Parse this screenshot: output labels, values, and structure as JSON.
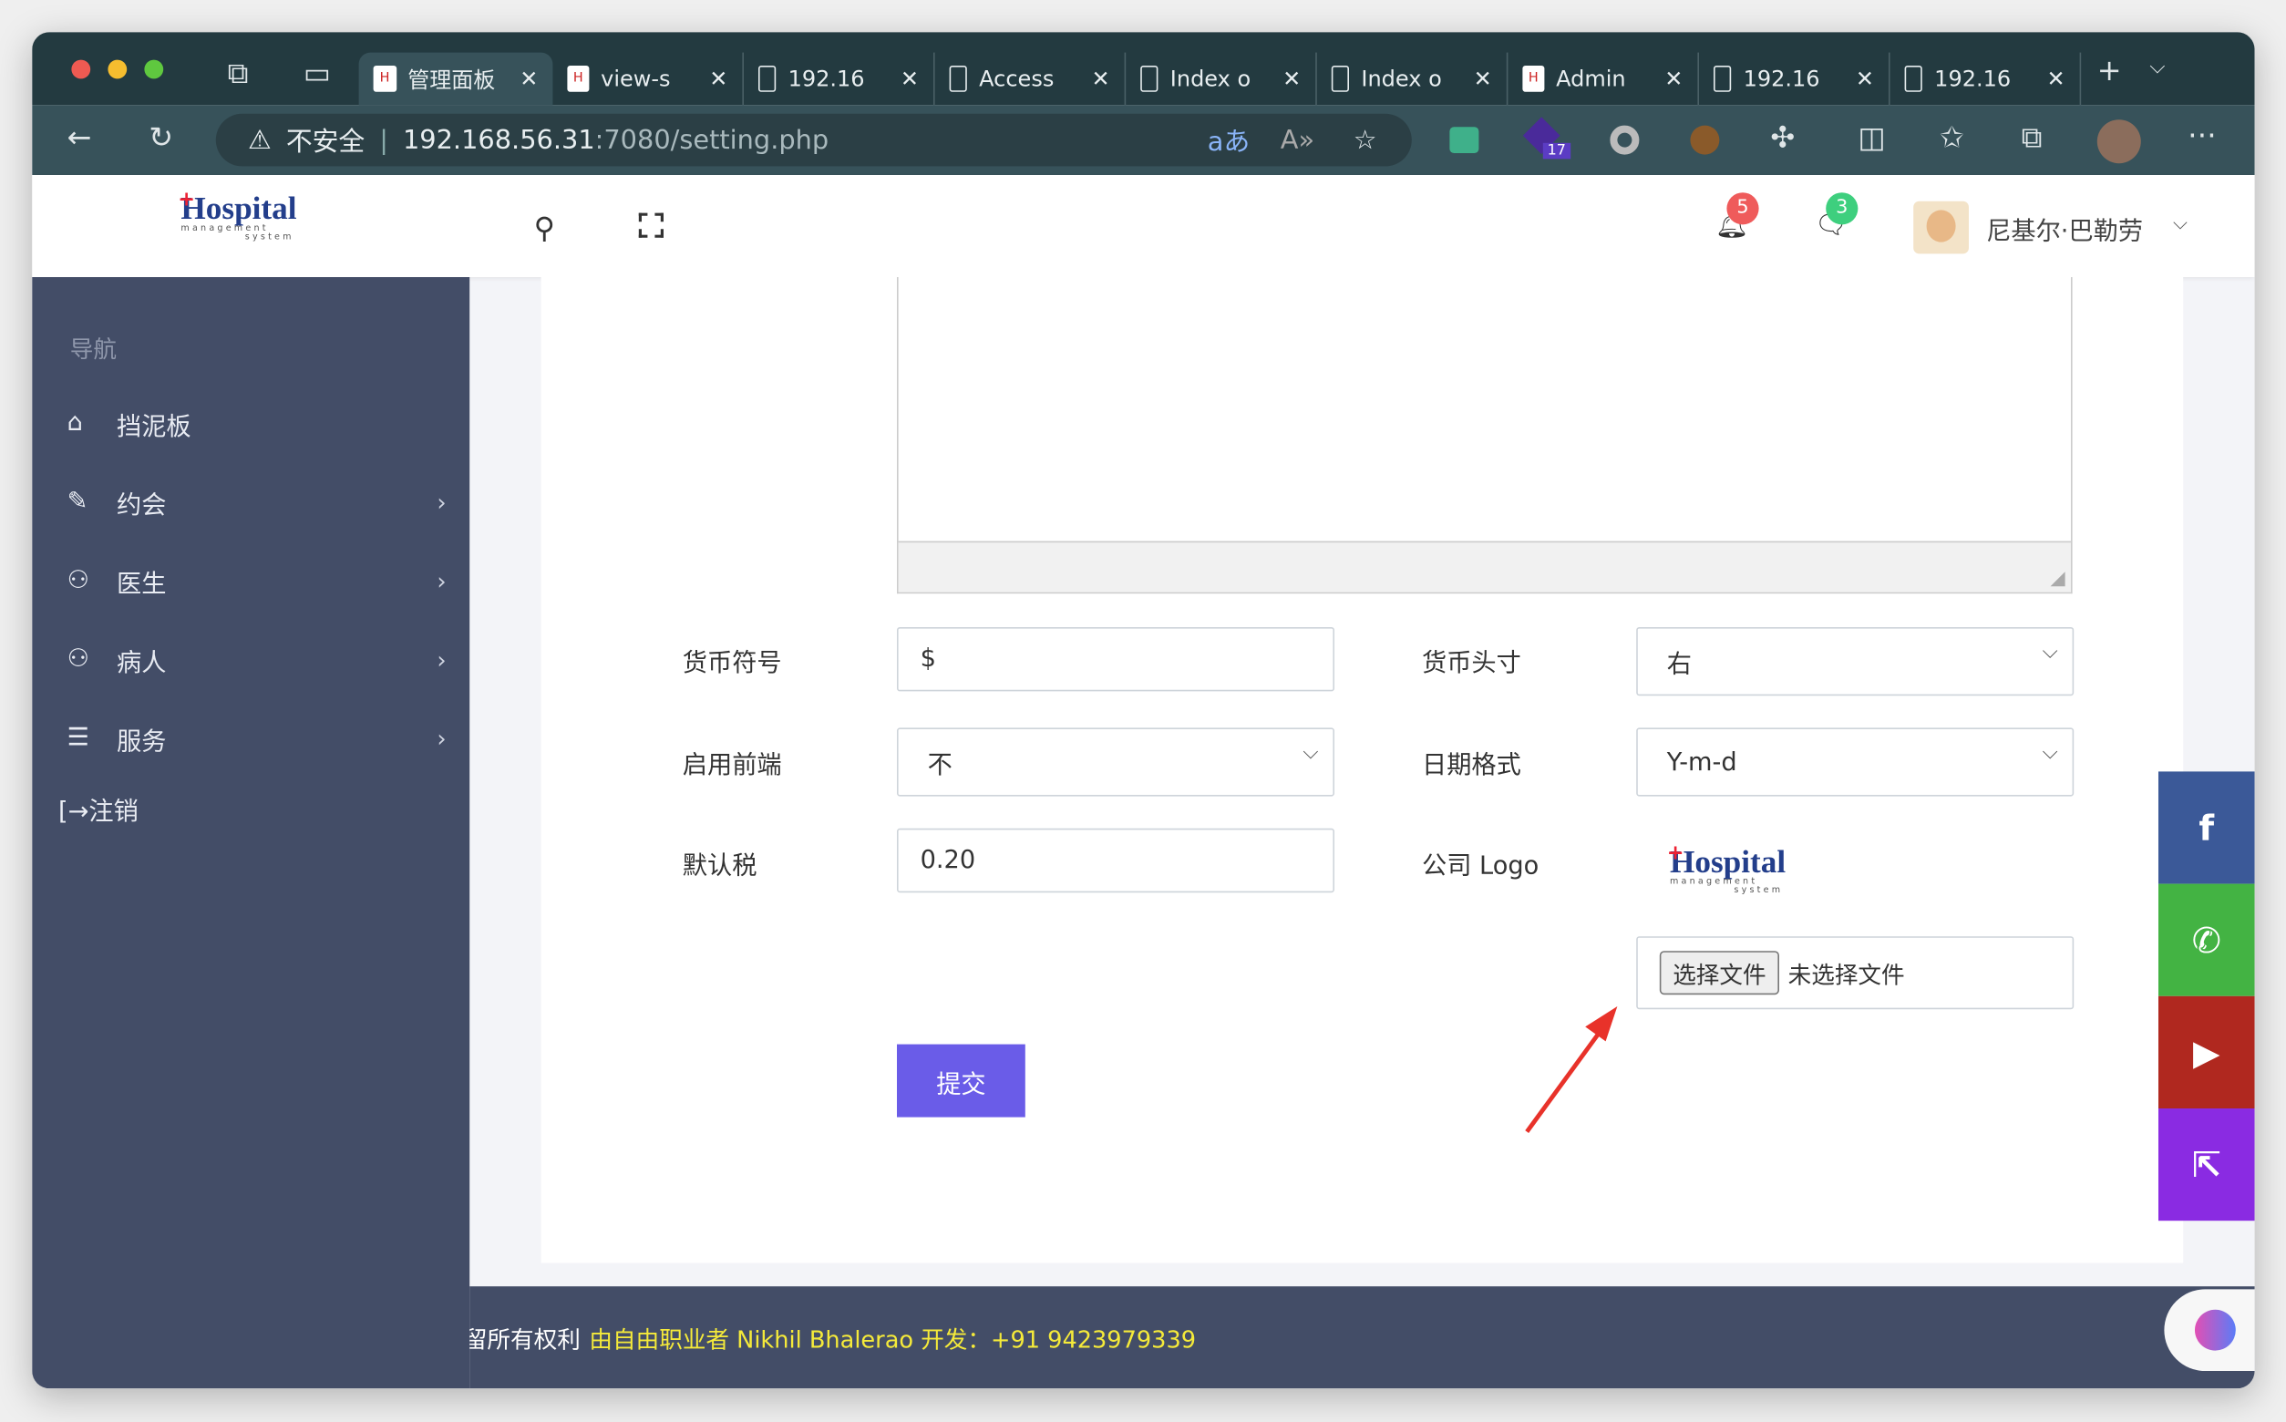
{
  "browser": {
    "tabs": [
      {
        "label": "管理面板",
        "icon": "hospital-favicon",
        "active": true
      },
      {
        "label": "view-s",
        "icon": "hospital-favicon"
      },
      {
        "label": "192.16",
        "icon": "page-icon"
      },
      {
        "label": "Access",
        "icon": "page-icon"
      },
      {
        "label": "Index o",
        "icon": "page-icon"
      },
      {
        "label": "Index o",
        "icon": "page-icon"
      },
      {
        "label": "Admin",
        "icon": "hospital-favicon"
      },
      {
        "label": "192.16",
        "icon": "page-icon"
      },
      {
        "label": "192.16",
        "icon": "page-icon"
      }
    ],
    "security_label": "不安全",
    "url_host": "192.168.56.31",
    "url_rest": ":7080/setting.php",
    "extension_badge": "17"
  },
  "header": {
    "logo": {
      "main": "Hospital",
      "sub1": "management",
      "sub2": "system"
    },
    "notifications_count": "5",
    "messages_count": "3",
    "user_name": "尼基尔·巴勒劳"
  },
  "sidebar": {
    "section_title": "导航",
    "items": [
      {
        "label": "挡泥板",
        "icon": "home-icon",
        "has_children": false
      },
      {
        "label": "约会",
        "icon": "edit-icon",
        "has_children": true
      },
      {
        "label": "医生",
        "icon": "user-icon",
        "has_children": true
      },
      {
        "label": "病人",
        "icon": "user-icon",
        "has_children": true
      },
      {
        "label": "服务",
        "icon": "menu-icon",
        "has_children": true
      }
    ],
    "logout_label": "[→注销"
  },
  "form": {
    "currency_symbol": {
      "label": "货币符号",
      "value": "$"
    },
    "currency_position": {
      "label": "货币头寸",
      "value": "右"
    },
    "enable_frontend": {
      "label": "启用前端",
      "value": "不"
    },
    "date_format": {
      "label": "日期格式",
      "value": "Y-m-d"
    },
    "default_tax": {
      "label": "默认税",
      "value": "0.20"
    },
    "company_logo": {
      "label": "公司 Logo",
      "choose_button": "选择文件",
      "no_file": "未选择文件"
    },
    "submit_label": "提交"
  },
  "social": [
    {
      "name": "facebook",
      "color": "#3b5998"
    },
    {
      "name": "whatsapp",
      "color": "#43b343"
    },
    {
      "name": "youtube",
      "color": "#b0281f"
    },
    {
      "name": "share",
      "color": "#8a2be2"
    }
  ],
  "footer": {
    "prefix": "留所有权利",
    "credit": "由自由职业者 Nikhil Bhalerao 开发：+91 9423979339"
  },
  "colors": {
    "sidebar": "#434d67",
    "accent": "#6a5ce8",
    "footer_link": "#f5ea3a"
  }
}
